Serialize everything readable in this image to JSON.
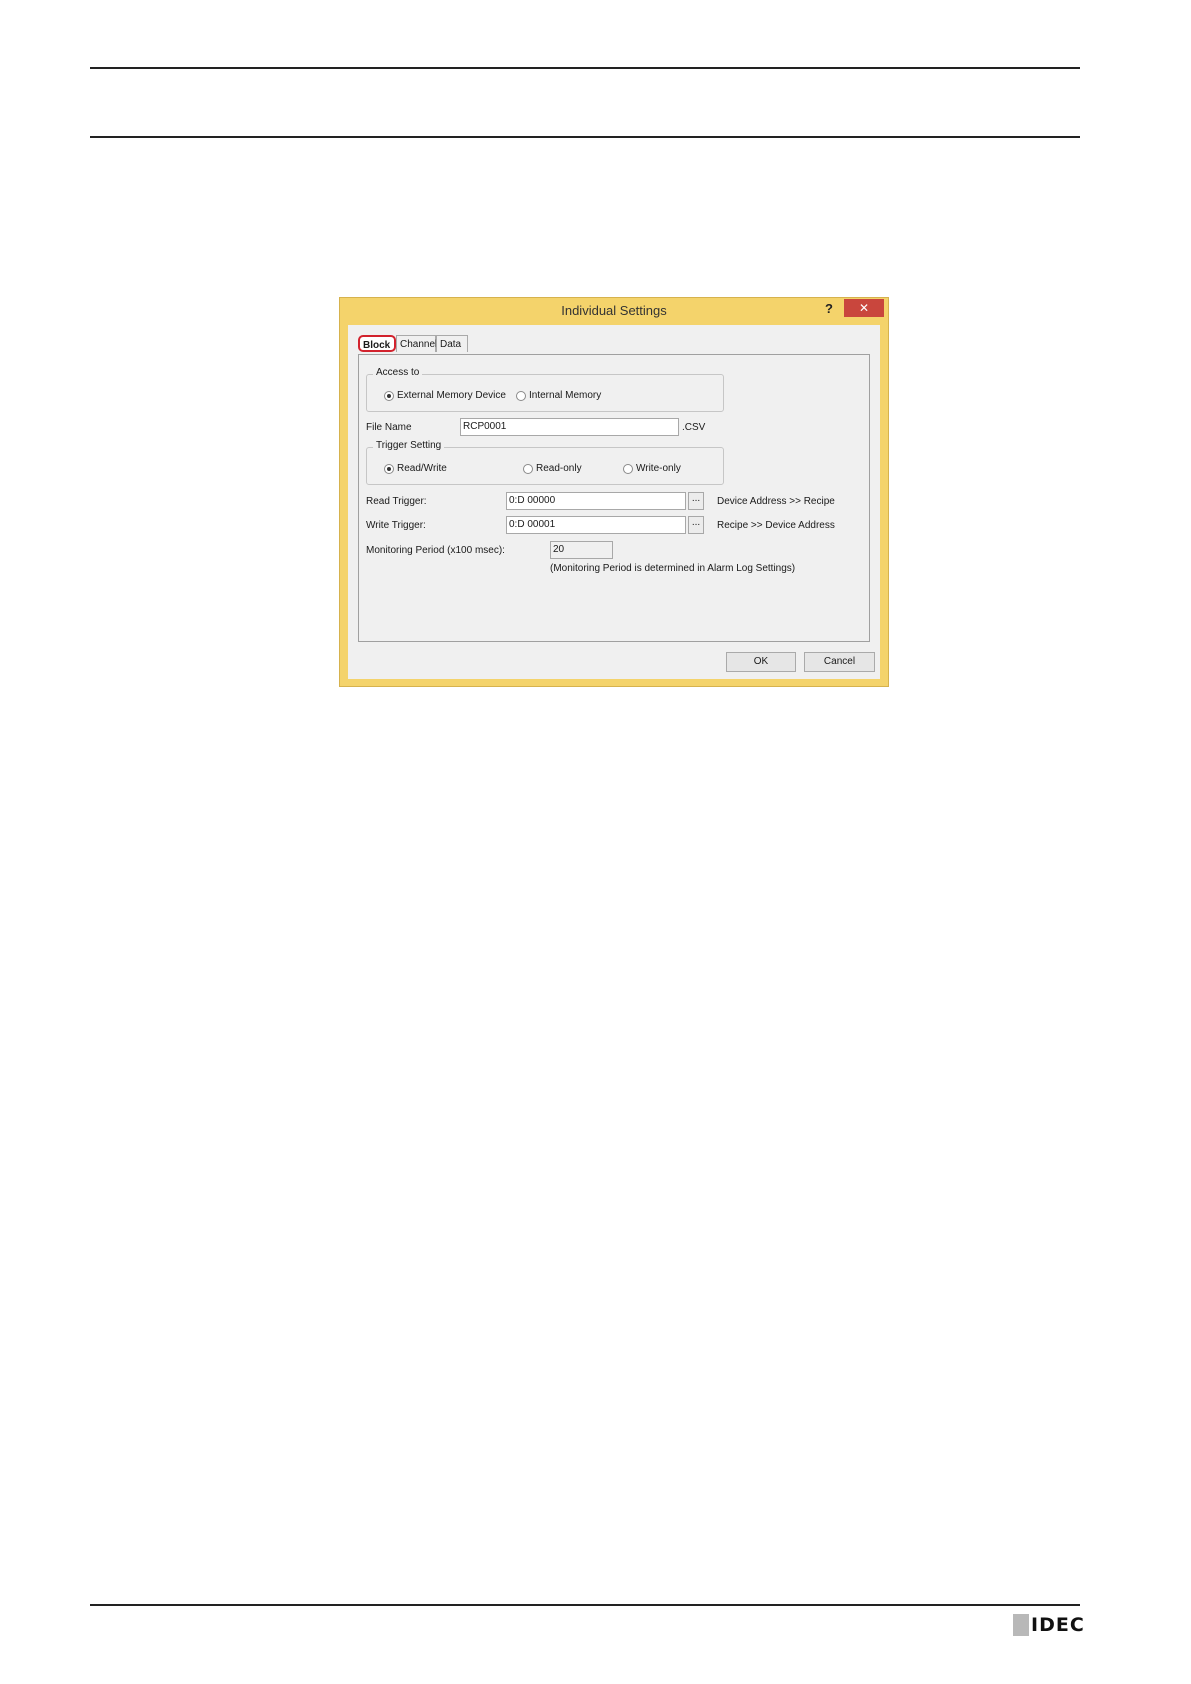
{
  "dialog": {
    "title": "Individual Settings",
    "help_label": "?",
    "close_label": "✕",
    "tabs": [
      {
        "label": "Block"
      },
      {
        "label": "Channel"
      },
      {
        "label": "Data"
      }
    ],
    "access_to": {
      "legend": "Access to",
      "options": [
        {
          "label": "External Memory Device",
          "selected": true
        },
        {
          "label": "Internal Memory",
          "selected": false
        }
      ]
    },
    "file_name": {
      "label": "File Name",
      "value": "RCP0001",
      "extension": ".CSV"
    },
    "trigger_setting": {
      "legend": "Trigger Setting",
      "options": [
        {
          "label": "Read/Write",
          "selected": true
        },
        {
          "label": "Read-only",
          "selected": false
        },
        {
          "label": "Write-only",
          "selected": false
        }
      ]
    },
    "read_trigger": {
      "label": "Read Trigger:",
      "value": "0:D 00000",
      "browse_label": "...",
      "note": "Device Address >> Recipe"
    },
    "write_trigger": {
      "label": "Write Trigger:",
      "value": "0:D 00001",
      "browse_label": "...",
      "note": "Recipe >> Device Address"
    },
    "monitoring_period": {
      "label": "Monitoring Period (x100 msec):",
      "value": "20",
      "note": "(Monitoring Period is determined in Alarm Log Settings)"
    },
    "ok_label": "OK",
    "cancel_label": "Cancel"
  },
  "footer": {
    "logo_text": "IDEC"
  }
}
